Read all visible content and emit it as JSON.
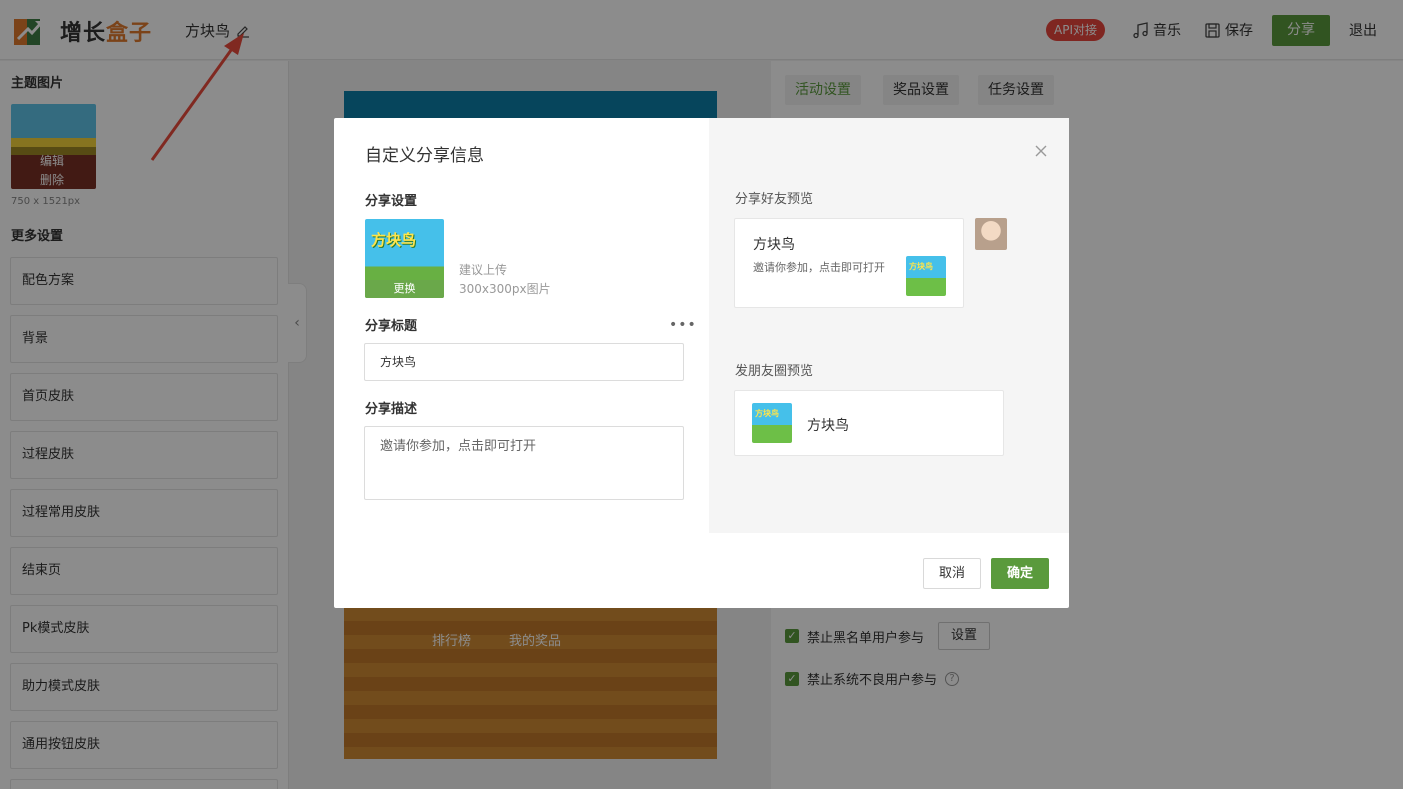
{
  "header": {
    "brand_part1": "增长",
    "brand_part2": "盒子",
    "activity_title": "方块鸟",
    "api_badge": "API对接",
    "music_label": "音乐",
    "save_label": "保存",
    "share_label": "分享",
    "exit_label": "退出",
    "accent_color": "#5a9a3c"
  },
  "sidebar": {
    "theme_image_title": "主题图片",
    "theme_edit": "编辑",
    "theme_delete": "删除",
    "theme_size": "750 x 1521px",
    "more_settings_title": "更多设置",
    "items": [
      {
        "label": "配色方案"
      },
      {
        "label": "背景"
      },
      {
        "label": "首页皮肤"
      },
      {
        "label": "过程皮肤"
      },
      {
        "label": "过程常用皮肤"
      },
      {
        "label": "结束页"
      },
      {
        "label": "Pk模式皮肤"
      },
      {
        "label": "助力模式皮肤"
      },
      {
        "label": "通用按钮皮肤"
      }
    ]
  },
  "preview": {
    "nav_rank": "排行榜",
    "nav_prizes": "我的奖品"
  },
  "right_panel": {
    "tabs": [
      {
        "label": "活动设置",
        "active": true
      },
      {
        "label": "奖品设置",
        "active": false
      },
      {
        "label": "任务设置",
        "active": false
      }
    ],
    "blacklist_label": "禁止黑名单用户参与",
    "blacklist_button": "设置",
    "bad_user_label": "禁止系统不良用户参与"
  },
  "modal": {
    "title": "自定义分享信息",
    "share_settings_label": "分享设置",
    "share_image_text": "方块鸟",
    "replace_label": "更换",
    "upload_hint": "建议上传300x300px图片",
    "share_title_label": "分享标题",
    "share_title_value": "方块鸟",
    "share_desc_label": "分享描述",
    "share_desc_value": "邀请你参加，点击即可打开",
    "friend_preview_label": "分享好友预览",
    "friend_card_title": "方块鸟",
    "friend_card_desc": "邀请你参加，点击即可打开",
    "moments_preview_label": "发朋友圈预览",
    "moments_card_title": "方块鸟",
    "cancel_label": "取消",
    "ok_label": "确定"
  }
}
